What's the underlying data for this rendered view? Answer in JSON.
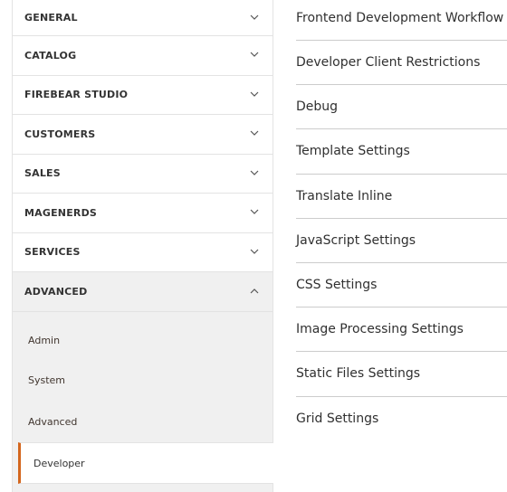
{
  "sidebar": {
    "sections": [
      {
        "label": "GENERAL",
        "expanded": false
      },
      {
        "label": "CATALOG",
        "expanded": false
      },
      {
        "label": "FIREBEAR STUDIO",
        "expanded": false
      },
      {
        "label": "CUSTOMERS",
        "expanded": false
      },
      {
        "label": "SALES",
        "expanded": false
      },
      {
        "label": "MAGENERDS",
        "expanded": false
      },
      {
        "label": "SERVICES",
        "expanded": false
      },
      {
        "label": "ADVANCED",
        "expanded": true
      }
    ],
    "advanced_items": [
      {
        "label": "Admin",
        "active": false
      },
      {
        "label": "System",
        "active": false
      },
      {
        "label": "Advanced",
        "active": false
      },
      {
        "label": "Developer",
        "active": true
      }
    ],
    "accent_color": "#d4661d"
  },
  "main": {
    "groups": [
      {
        "label": "Frontend Development Workflow"
      },
      {
        "label": "Developer Client Restrictions"
      },
      {
        "label": "Debug"
      },
      {
        "label": "Template Settings"
      },
      {
        "label": "Translate Inline"
      },
      {
        "label": "JavaScript Settings"
      },
      {
        "label": "CSS Settings"
      },
      {
        "label": "Image Processing Settings"
      },
      {
        "label": "Static Files Settings"
      },
      {
        "label": "Grid Settings"
      }
    ]
  }
}
